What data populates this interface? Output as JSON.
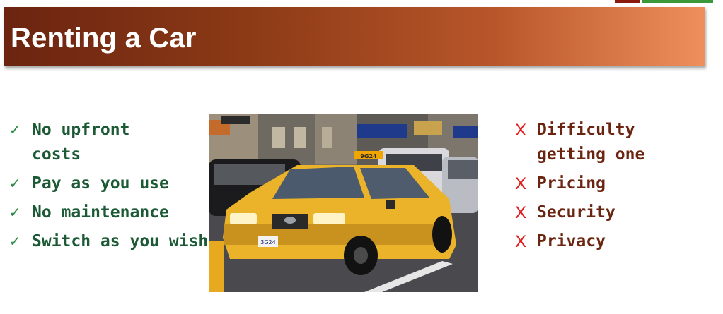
{
  "slide": {
    "title": "Renting a Car"
  },
  "pros": {
    "items": [
      {
        "icon": "checkmark-icon",
        "mark": "✓",
        "text": "No upfront costs"
      },
      {
        "icon": "checkmark-icon",
        "mark": "✓",
        "text": "Pay as you use"
      },
      {
        "icon": "checkmark-icon",
        "mark": "✓",
        "text": "No maintenance"
      },
      {
        "icon": "checkmark-icon",
        "mark": "✓",
        "text": "Switch as you wish"
      }
    ]
  },
  "cons": {
    "items": [
      {
        "icon": "x-icon",
        "mark": "X",
        "text": "Difficulty getting one"
      },
      {
        "icon": "x-icon",
        "mark": "X",
        "text": "Pricing"
      },
      {
        "icon": "x-icon",
        "mark": "X",
        "text": "Security"
      },
      {
        "icon": "x-icon",
        "mark": "X",
        "text": "Privacy"
      }
    ]
  },
  "photo": {
    "taxi_roof_sign": "9G24",
    "license_plate": "3G24"
  },
  "colors": {
    "title_bar_start": "#6b2410",
    "title_bar_end": "#ee8f5c",
    "pros_text": "#1b5a34",
    "cons_text": "#6b2410",
    "x_mark": "#e11a1a"
  }
}
